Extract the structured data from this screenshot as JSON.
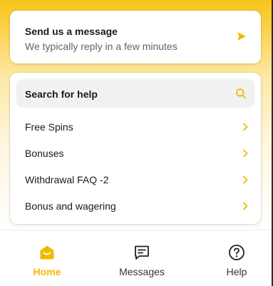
{
  "colors": {
    "accent": "#f5b800",
    "header_gradient_top": "#f8c31a",
    "card_bg": "#ffffff",
    "search_bg": "#f1f1f1",
    "text_primary": "#1a1a1a",
    "text_secondary": "#5f6368"
  },
  "message_card": {
    "title": "Send us a message",
    "subtitle": "We typically reply in a few minutes",
    "icon": "send-icon"
  },
  "help": {
    "search_label": "Search for help",
    "search_icon": "search-icon",
    "items": [
      {
        "label": "Free Spins",
        "icon": "chevron-right-icon"
      },
      {
        "label": "Bonuses",
        "icon": "chevron-right-icon"
      },
      {
        "label": "Withdrawal FAQ -2",
        "icon": "chevron-right-icon"
      },
      {
        "label": "Bonus and wagering",
        "icon": "chevron-right-icon"
      }
    ]
  },
  "nav": {
    "tabs": [
      {
        "label": "Home",
        "icon": "home-icon",
        "active": true
      },
      {
        "label": "Messages",
        "icon": "messages-icon",
        "active": false
      },
      {
        "label": "Help",
        "icon": "help-icon",
        "active": false
      }
    ]
  }
}
